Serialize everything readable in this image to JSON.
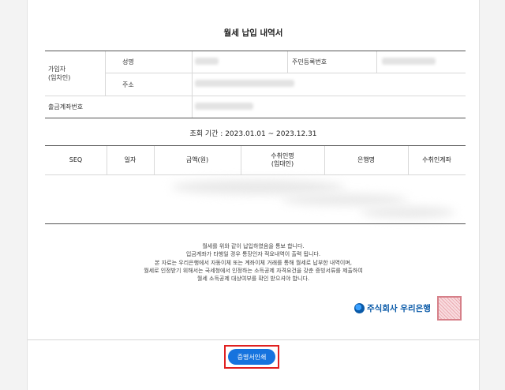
{
  "title": "월세 납입 내역서",
  "info": {
    "subscriber_label": "가입자",
    "subscriber_sub_label": "(임차인)",
    "name_label": "성명",
    "resident_no_label": "주민등록번호",
    "address_label": "주소",
    "account_label": "출금계좌번호"
  },
  "period": "조회 기간 : 2023.01.01 ~ 2023.12.31",
  "table": {
    "headers": [
      "SEQ",
      "일자",
      "금액(원)",
      "수취인명\n(임대인)",
      "은행명",
      "수취인계좌"
    ]
  },
  "notice": [
    "월세를 위와 같이 납입하였음을 통보 합니다.",
    "입금계좌가 타행일 경우 통장인자 적요내역이 출력 됩니다.",
    "본 자료는 우리은행에서 자동이체 또는 계좌이체 거래를 통해 월세로 납부한 내역이며,",
    "월세로 인정받기 위해서는 국세청에서 인정하는 소득공제 자격요건을 갖춘 증빙서류를 제출하여",
    "월세 소득공제 대상여부를 확인 받으셔야 합니다."
  ],
  "brand": "주식회사 우리은행",
  "print_button": "증명서인쇄",
  "colors": {
    "accent": "#1673de",
    "brand": "#0a5aa8",
    "highlight": "#e02020"
  }
}
